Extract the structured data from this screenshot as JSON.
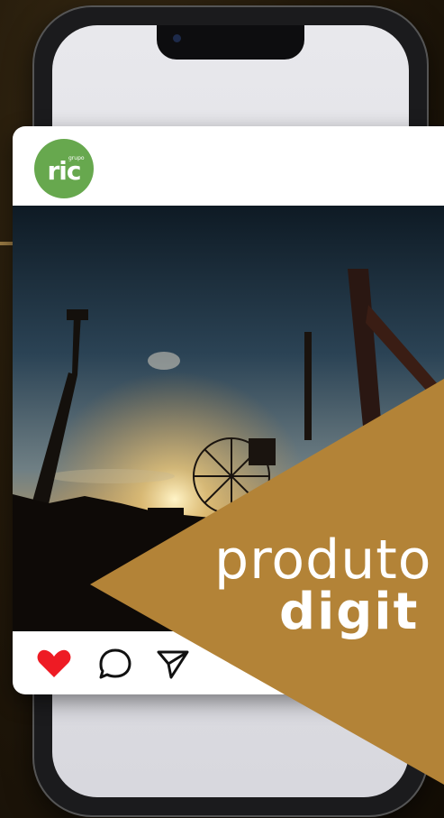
{
  "post": {
    "avatar_text": "ric",
    "avatar_small": "grupo"
  },
  "promo": {
    "line1": "produto",
    "line2": "digit"
  },
  "colors": {
    "brand_green": "#67a84e",
    "promo_gold": "#b38337",
    "like_red": "#ee1b24"
  },
  "icons": [
    "heart-icon",
    "comment-icon",
    "share-icon"
  ]
}
